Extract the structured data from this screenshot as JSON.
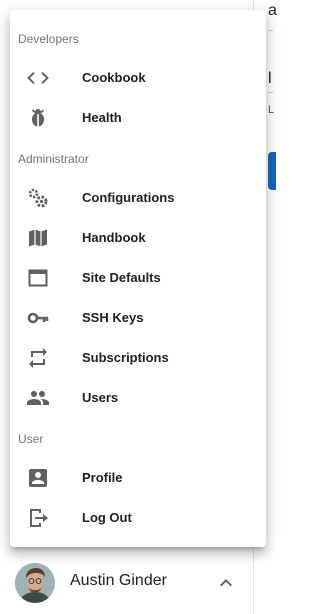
{
  "background": {
    "char_a": "a",
    "char_l": "l",
    "char_small": "L"
  },
  "menu": {
    "sections": [
      {
        "header": "Developers",
        "items": [
          {
            "label": "Cookbook",
            "icon": "code-icon"
          },
          {
            "label": "Health",
            "icon": "bug-icon"
          }
        ]
      },
      {
        "header": "Administrator",
        "items": [
          {
            "label": "Configurations",
            "icon": "gears-icon"
          },
          {
            "label": "Handbook",
            "icon": "map-icon"
          },
          {
            "label": "Site Defaults",
            "icon": "window-icon"
          },
          {
            "label": "SSH Keys",
            "icon": "key-icon"
          },
          {
            "label": "Subscriptions",
            "icon": "repeat-icon"
          },
          {
            "label": "Users",
            "icon": "people-icon"
          }
        ]
      },
      {
        "header": "User",
        "items": [
          {
            "label": "Profile",
            "icon": "account-box-icon"
          },
          {
            "label": "Log Out",
            "icon": "logout-icon"
          }
        ]
      }
    ]
  },
  "user": {
    "name": "Austin Ginder",
    "toggle_icon": "chevron-up-icon"
  },
  "colors": {
    "icon": "#616161",
    "accent": "#1565c0"
  }
}
